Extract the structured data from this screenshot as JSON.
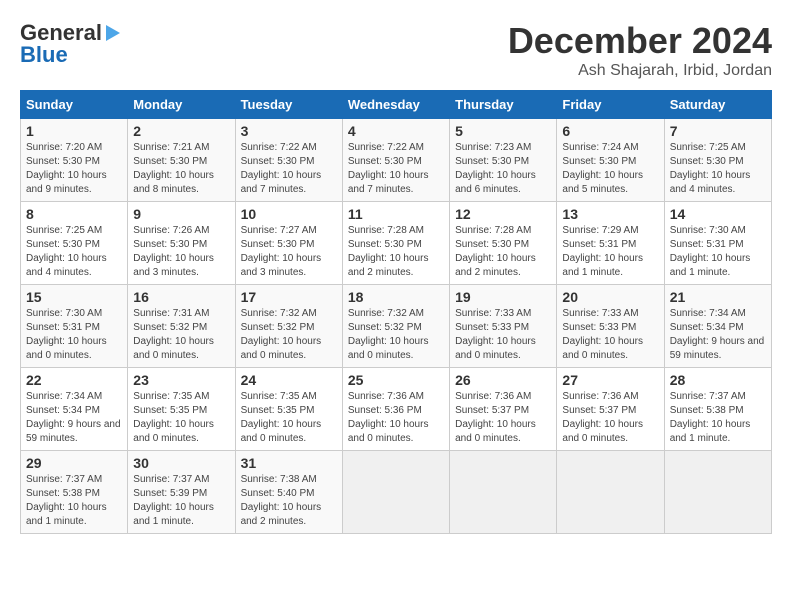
{
  "header": {
    "logo_line1": "General",
    "logo_line2": "Blue",
    "month_title": "December 2024",
    "subtitle": "Ash Shajarah, Irbid, Jordan"
  },
  "calendar": {
    "days_of_week": [
      "Sunday",
      "Monday",
      "Tuesday",
      "Wednesday",
      "Thursday",
      "Friday",
      "Saturday"
    ],
    "weeks": [
      [
        {
          "day": "",
          "empty": true
        },
        {
          "day": "",
          "empty": true
        },
        {
          "day": "",
          "empty": true
        },
        {
          "day": "",
          "empty": true
        },
        {
          "day": "5",
          "sunrise": "7:23 AM",
          "sunset": "5:30 PM",
          "daylight": "10 hours and 6 minutes."
        },
        {
          "day": "6",
          "sunrise": "7:24 AM",
          "sunset": "5:30 PM",
          "daylight": "10 hours and 5 minutes."
        },
        {
          "day": "7",
          "sunrise": "7:25 AM",
          "sunset": "5:30 PM",
          "daylight": "10 hours and 4 minutes."
        }
      ],
      [
        {
          "day": "1",
          "sunrise": "7:20 AM",
          "sunset": "5:30 PM",
          "daylight": "10 hours and 9 minutes."
        },
        {
          "day": "2",
          "sunrise": "7:21 AM",
          "sunset": "5:30 PM",
          "daylight": "10 hours and 8 minutes."
        },
        {
          "day": "3",
          "sunrise": "7:22 AM",
          "sunset": "5:30 PM",
          "daylight": "10 hours and 7 minutes."
        },
        {
          "day": "4",
          "sunrise": "7:22 AM",
          "sunset": "5:30 PM",
          "daylight": "10 hours and 7 minutes."
        },
        {
          "day": "5",
          "sunrise": "7:23 AM",
          "sunset": "5:30 PM",
          "daylight": "10 hours and 6 minutes."
        },
        {
          "day": "6",
          "sunrise": "7:24 AM",
          "sunset": "5:30 PM",
          "daylight": "10 hours and 5 minutes."
        },
        {
          "day": "7",
          "sunrise": "7:25 AM",
          "sunset": "5:30 PM",
          "daylight": "10 hours and 4 minutes."
        }
      ],
      [
        {
          "day": "8",
          "sunrise": "7:25 AM",
          "sunset": "5:30 PM",
          "daylight": "10 hours and 4 minutes."
        },
        {
          "day": "9",
          "sunrise": "7:26 AM",
          "sunset": "5:30 PM",
          "daylight": "10 hours and 3 minutes."
        },
        {
          "day": "10",
          "sunrise": "7:27 AM",
          "sunset": "5:30 PM",
          "daylight": "10 hours and 3 minutes."
        },
        {
          "day": "11",
          "sunrise": "7:28 AM",
          "sunset": "5:30 PM",
          "daylight": "10 hours and 2 minutes."
        },
        {
          "day": "12",
          "sunrise": "7:28 AM",
          "sunset": "5:30 PM",
          "daylight": "10 hours and 2 minutes."
        },
        {
          "day": "13",
          "sunrise": "7:29 AM",
          "sunset": "5:31 PM",
          "daylight": "10 hours and 1 minute."
        },
        {
          "day": "14",
          "sunrise": "7:30 AM",
          "sunset": "5:31 PM",
          "daylight": "10 hours and 1 minute."
        }
      ],
      [
        {
          "day": "15",
          "sunrise": "7:30 AM",
          "sunset": "5:31 PM",
          "daylight": "10 hours and 0 minutes."
        },
        {
          "day": "16",
          "sunrise": "7:31 AM",
          "sunset": "5:32 PM",
          "daylight": "10 hours and 0 minutes."
        },
        {
          "day": "17",
          "sunrise": "7:32 AM",
          "sunset": "5:32 PM",
          "daylight": "10 hours and 0 minutes."
        },
        {
          "day": "18",
          "sunrise": "7:32 AM",
          "sunset": "5:32 PM",
          "daylight": "10 hours and 0 minutes."
        },
        {
          "day": "19",
          "sunrise": "7:33 AM",
          "sunset": "5:33 PM",
          "daylight": "10 hours and 0 minutes."
        },
        {
          "day": "20",
          "sunrise": "7:33 AM",
          "sunset": "5:33 PM",
          "daylight": "10 hours and 0 minutes."
        },
        {
          "day": "21",
          "sunrise": "7:34 AM",
          "sunset": "5:34 PM",
          "daylight": "9 hours and 59 minutes."
        }
      ],
      [
        {
          "day": "22",
          "sunrise": "7:34 AM",
          "sunset": "5:34 PM",
          "daylight": "9 hours and 59 minutes."
        },
        {
          "day": "23",
          "sunrise": "7:35 AM",
          "sunset": "5:35 PM",
          "daylight": "10 hours and 0 minutes."
        },
        {
          "day": "24",
          "sunrise": "7:35 AM",
          "sunset": "5:35 PM",
          "daylight": "10 hours and 0 minutes."
        },
        {
          "day": "25",
          "sunrise": "7:36 AM",
          "sunset": "5:36 PM",
          "daylight": "10 hours and 0 minutes."
        },
        {
          "day": "26",
          "sunrise": "7:36 AM",
          "sunset": "5:37 PM",
          "daylight": "10 hours and 0 minutes."
        },
        {
          "day": "27",
          "sunrise": "7:36 AM",
          "sunset": "5:37 PM",
          "daylight": "10 hours and 0 minutes."
        },
        {
          "day": "28",
          "sunrise": "7:37 AM",
          "sunset": "5:38 PM",
          "daylight": "10 hours and 1 minute."
        }
      ],
      [
        {
          "day": "29",
          "sunrise": "7:37 AM",
          "sunset": "5:38 PM",
          "daylight": "10 hours and 1 minute."
        },
        {
          "day": "30",
          "sunrise": "7:37 AM",
          "sunset": "5:39 PM",
          "daylight": "10 hours and 1 minute."
        },
        {
          "day": "31",
          "sunrise": "7:38 AM",
          "sunset": "5:40 PM",
          "daylight": "10 hours and 2 minutes."
        },
        {
          "day": "",
          "empty": true
        },
        {
          "day": "",
          "empty": true
        },
        {
          "day": "",
          "empty": true
        },
        {
          "day": "",
          "empty": true
        }
      ]
    ]
  }
}
